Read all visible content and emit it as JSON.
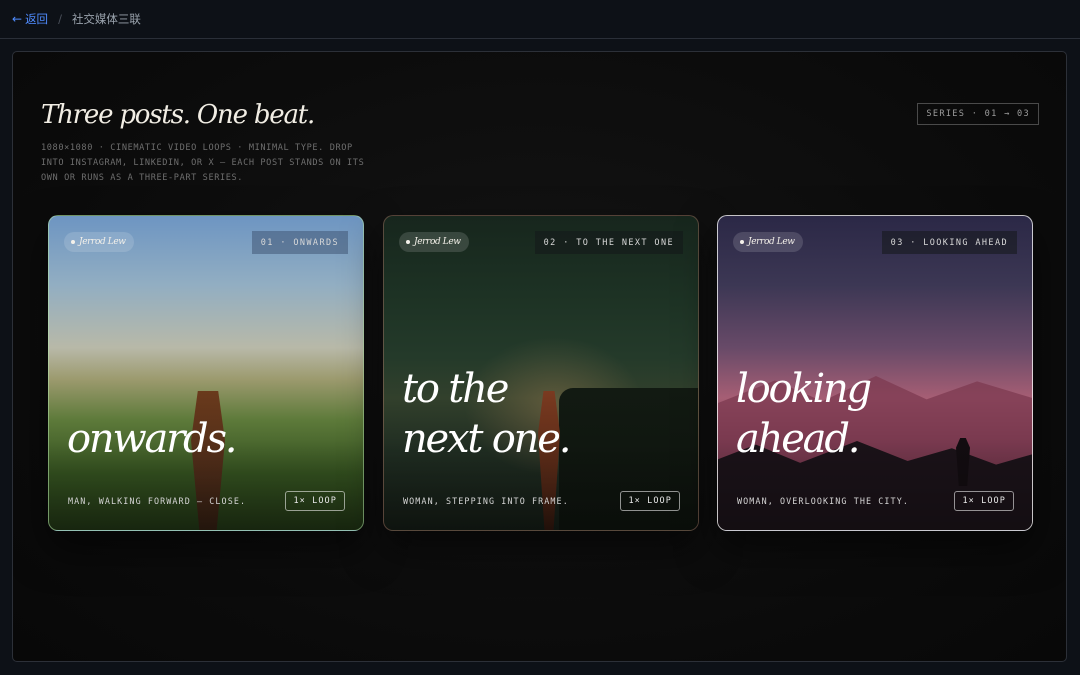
{
  "topbar": {
    "back_label": "返回",
    "separator": "/",
    "title": "社交媒体三联"
  },
  "header": {
    "headline": "Three posts. One beat.",
    "subcopy": "1080×1080 · CINEMATIC VIDEO LOOPS · MINIMAL TYPE. DROP INTO INSTAGRAM, LINKEDIN, OR X — EACH POST STANDS ON ITS OWN OR RUNS AS A THREE-PART SERIES.",
    "series_badge": "SERIES · 01 → 03"
  },
  "cards": [
    {
      "author": "Jerrod Lew",
      "tag": "01 · ONWARDS",
      "title_line1": "onwards.",
      "title_line2": "",
      "caption": "MAN, WALKING FORWARD — CLOSE.",
      "loop": "1× LOOP"
    },
    {
      "author": "Jerrod Lew",
      "tag": "02 · TO THE NEXT ONE",
      "title_line1": "to the",
      "title_line2": "next one.",
      "caption": "WOMAN, STEPPING INTO FRAME.",
      "loop": "1× LOOP"
    },
    {
      "author": "Jerrod Lew",
      "tag": "03 · LOOKING AHEAD",
      "title_line1": "looking",
      "title_line2": "ahead.",
      "caption": "WOMAN, OVERLOOKING THE CITY.",
      "loop": "1× LOOP"
    }
  ],
  "icons": {
    "back": "arrow-left-icon"
  },
  "colors": {
    "accent": "#4f8cff",
    "background": "#0d1117",
    "panel": "#0b0b0b"
  }
}
